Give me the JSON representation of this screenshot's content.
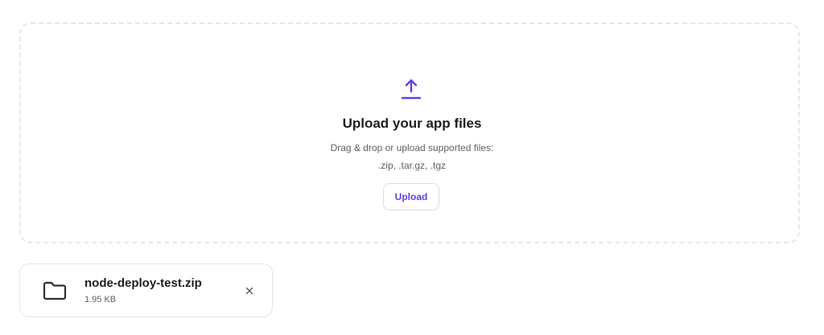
{
  "dropzone": {
    "icon": "upload-arrow-icon",
    "title": "Upload your app files",
    "description": "Drag & drop or upload supported files:",
    "file_types": ".zip, .tar.gz, .tgz",
    "upload_label": "Upload"
  },
  "file": {
    "icon": "folder-icon",
    "name": "node-deploy-test.zip",
    "size": "1.95 KB",
    "remove_icon": "close-icon"
  },
  "colors": {
    "accent": "#673de6",
    "text_primary": "#1d1e20",
    "text_secondary": "#5f6066",
    "border": "#e3e4e8"
  }
}
